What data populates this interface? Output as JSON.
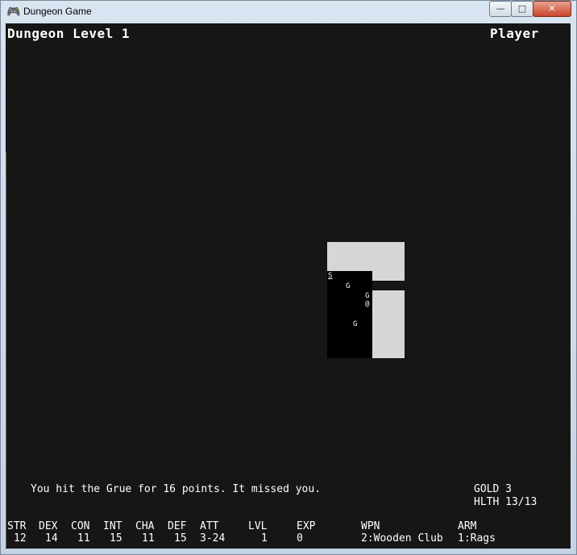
{
  "window": {
    "title": "Dungeon Game",
    "icon": "game-controller-icon",
    "minimize_glyph": "—",
    "maximize_glyph": "□",
    "close_glyph": "✕"
  },
  "header": {
    "level_title": "Dungeon Level 1",
    "player_name": "Player"
  },
  "map": {
    "tiles": [
      {
        "glyph": "S",
        "name": "map-tile-stairs"
      },
      {
        "glyph": "G",
        "name": "map-tile-grue-1"
      },
      {
        "glyph": "G",
        "name": "map-tile-grue-2"
      },
      {
        "glyph": "@",
        "name": "map-tile-player"
      },
      {
        "glyph": "G",
        "name": "map-tile-grue-3"
      }
    ]
  },
  "message": "You hit the Grue for 16 points. It missed you.",
  "status": {
    "gold": "GOLD 3",
    "health": "HLTH 13/13"
  },
  "stats": [
    {
      "label": "STR",
      "value": "12"
    },
    {
      "label": "DEX",
      "value": "14"
    },
    {
      "label": "CON",
      "value": "11"
    },
    {
      "label": "INT",
      "value": "15"
    },
    {
      "label": "CHA",
      "value": "11"
    },
    {
      "label": "DEF",
      "value": "15"
    },
    {
      "label": "ATT",
      "value": "3-24"
    },
    {
      "label": "LVL",
      "value": "1"
    },
    {
      "label": "EXP",
      "value": "0"
    },
    {
      "label": "WPN",
      "value": "2:Wooden Club"
    },
    {
      "label": "ARM",
      "value": "1:Rags"
    }
  ],
  "colors": {
    "background": "#161616",
    "text": "#ffffff",
    "lit_floor": "#eaeaea",
    "dark_floor": "#000000"
  }
}
